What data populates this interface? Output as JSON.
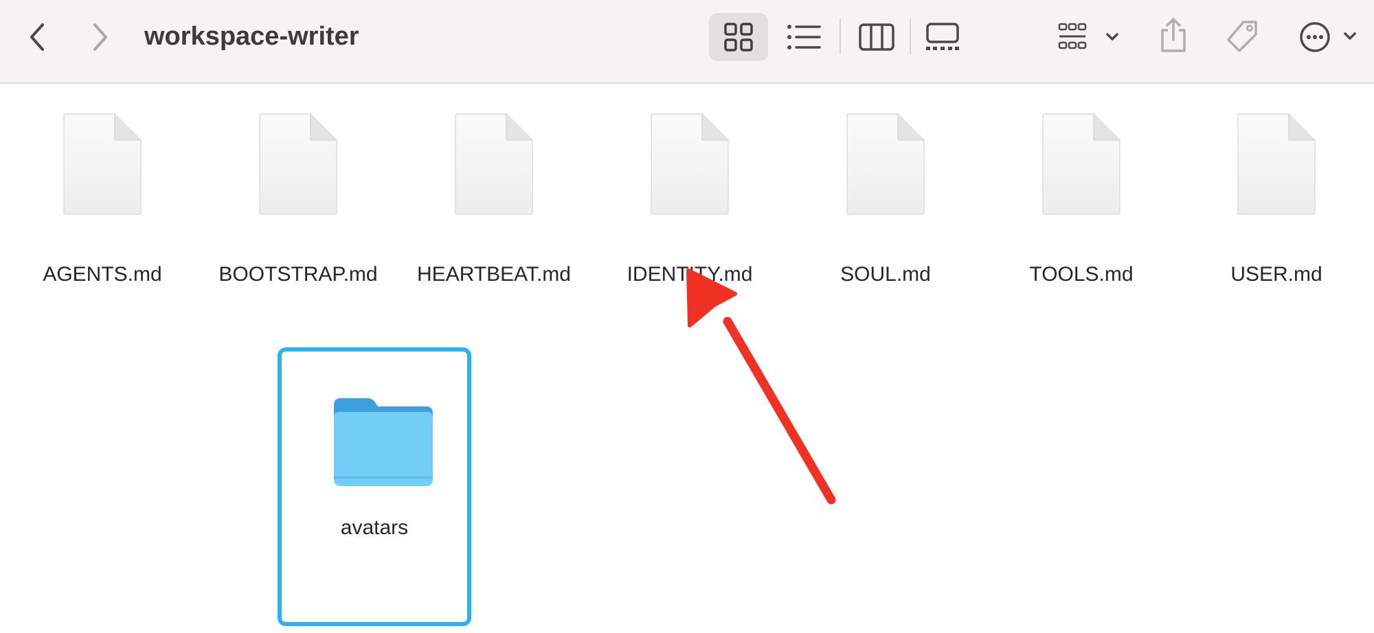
{
  "window": {
    "title": "workspace-writer"
  },
  "toolbar": {
    "buttons": [
      {
        "name": "back",
        "icon": "chevron-left-icon"
      },
      {
        "name": "forward",
        "icon": "chevron-right-icon"
      },
      {
        "name": "view-icons",
        "icon": "grid-icon",
        "active": true
      },
      {
        "name": "view-list",
        "icon": "list-icon"
      },
      {
        "name": "view-columns",
        "icon": "columns-icon"
      },
      {
        "name": "view-gallery",
        "icon": "gallery-icon"
      },
      {
        "name": "group",
        "icon": "group-icon"
      },
      {
        "name": "share",
        "icon": "share-icon"
      },
      {
        "name": "tags",
        "icon": "tag-icon"
      },
      {
        "name": "more",
        "icon": "ellipsis-icon"
      }
    ]
  },
  "files": [
    {
      "name": "AGENTS.md"
    },
    {
      "name": "BOOTSTRAP.md"
    },
    {
      "name": "HEARTBEAT.md"
    },
    {
      "name": "IDENTITY.md"
    },
    {
      "name": "SOUL.md"
    },
    {
      "name": "TOOLS.md"
    },
    {
      "name": "USER.md"
    }
  ],
  "folders": [
    {
      "name": "avatars",
      "selected": true
    }
  ],
  "annotation": {
    "type": "arrow",
    "color": "#f03124",
    "points_to": "IDENTITY.md"
  },
  "colors": {
    "toolbar_bg": "#f5f3f3",
    "selection_border": "#2cb0ee",
    "folder_blue": "#72cdf7"
  }
}
